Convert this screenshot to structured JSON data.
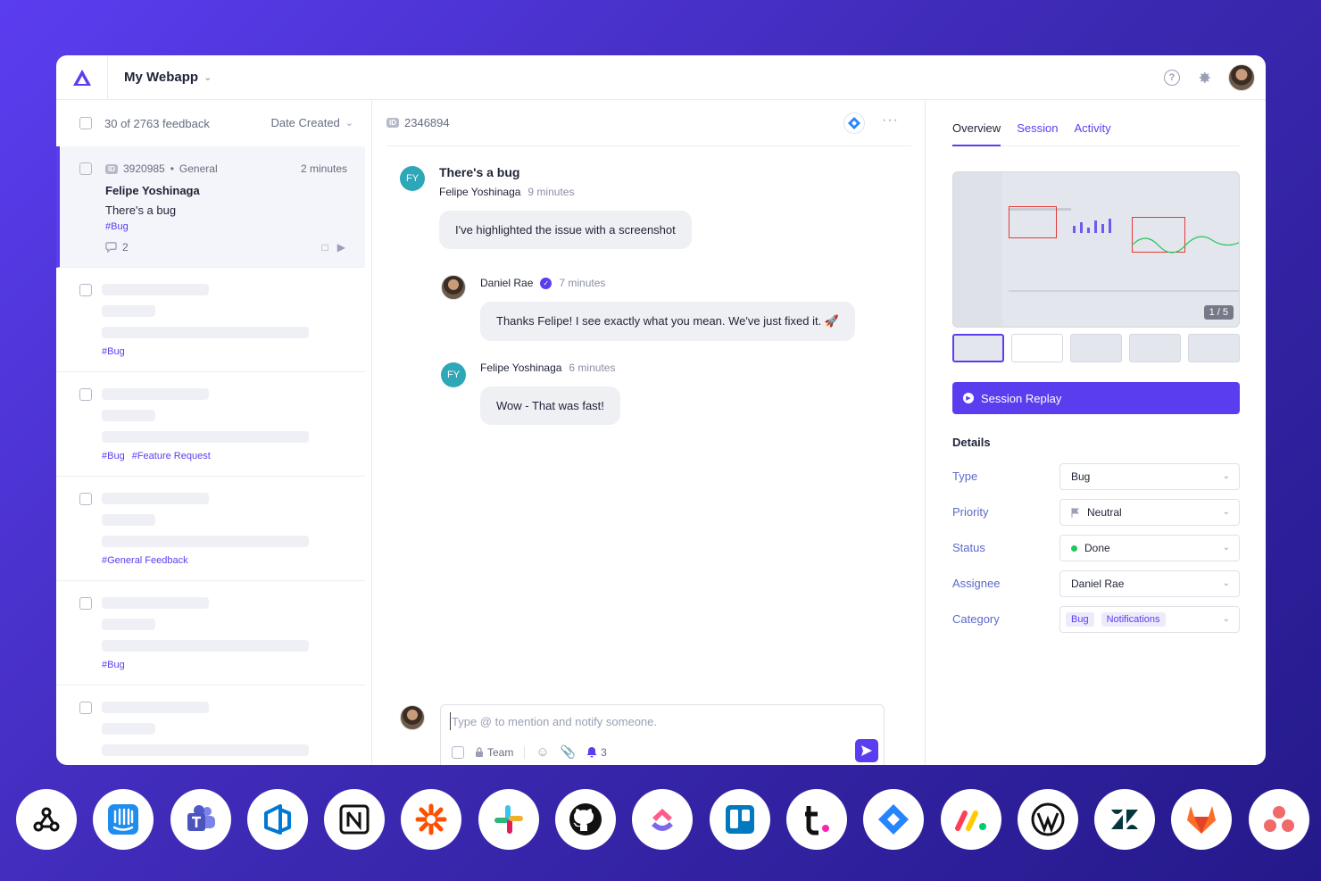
{
  "header": {
    "app_name": "My Webapp"
  },
  "list": {
    "count_label": "30 of 2763 feedback",
    "sort_label": "Date Created",
    "items": [
      {
        "id": "3920985",
        "category": "General",
        "time": "2 minutes",
        "author": "Felipe Yoshinaga",
        "subject": "There's a bug",
        "tags": [
          "#Bug"
        ],
        "comments": "2"
      },
      {
        "tags": [
          "#Bug"
        ]
      },
      {
        "tags": [
          "#Bug",
          "#Feature Request"
        ]
      },
      {
        "tags": [
          "#General Feedback"
        ]
      },
      {
        "tags": [
          "#Bug"
        ]
      },
      {
        "tags": []
      }
    ]
  },
  "conversation": {
    "feedback_id": "2346894",
    "title": "There's a bug",
    "messages": [
      {
        "initials": "FY",
        "author": "Felipe Yoshinaga",
        "time": "9 minutes",
        "text": "I've highlighted the issue with a screenshot"
      },
      {
        "author": "Daniel Rae",
        "time": "7 minutes",
        "text": "Thanks Felipe! I see exactly what you mean. We've just fixed it. 🚀"
      },
      {
        "initials": "FY",
        "author": "Felipe Yoshinaga",
        "time": "6 minutes",
        "text": "Wow - That was fast!"
      }
    ],
    "composer": {
      "placeholder": "Type @ to mention and notify someone.",
      "team_label": "Team",
      "notify_count": "3"
    }
  },
  "details": {
    "tabs": [
      "Overview",
      "Session",
      "Activity"
    ],
    "screenshot_pager": "1 / 5",
    "replay_label": "Session Replay",
    "heading": "Details",
    "fields": {
      "type": {
        "label": "Type",
        "value": "Bug"
      },
      "priority": {
        "label": "Priority",
        "value": "Neutral"
      },
      "status": {
        "label": "Status",
        "value": "Done"
      },
      "assignee": {
        "label": "Assignee",
        "value": "Daniel Rae"
      },
      "category": {
        "label": "Category",
        "values": [
          "Bug",
          "Notifications"
        ]
      }
    }
  },
  "integrations": [
    "webhook-icon",
    "intercom-icon",
    "teams-icon",
    "azure-devops-icon",
    "notion-icon",
    "zapier-icon",
    "slack-icon",
    "github-icon",
    "clickup-icon",
    "trello-icon",
    "teamwork-icon",
    "jira-icon",
    "monday-icon",
    "wordpress-icon",
    "zendesk-icon",
    "gitlab-icon",
    "asana-icon"
  ],
  "colors": {
    "accent": "#5b3df0",
    "background": "#3f2bb8",
    "status_done": "#22c55e"
  }
}
